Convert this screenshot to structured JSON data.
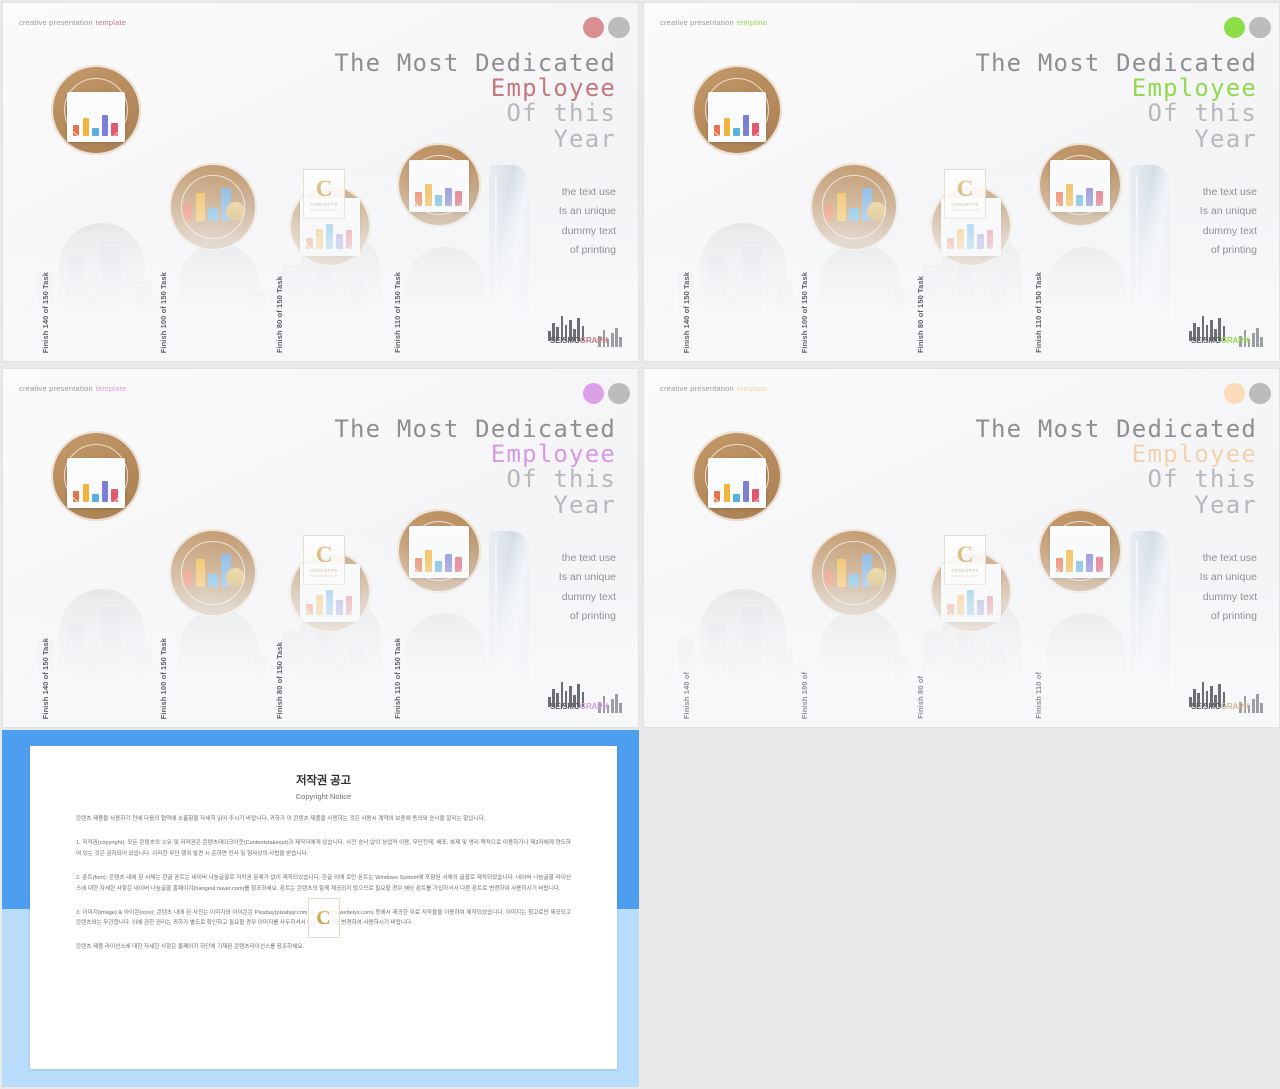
{
  "slides": [
    {
      "id": "slide-1",
      "accent": "#d98f92",
      "accent_text": "#c4787d",
      "eyebrow_plain": "creative presentation",
      "eyebrow_accent": "template",
      "headline": {
        "l1": "The Most Dedicated",
        "l2": "Employee",
        "l3": "Of this",
        "l4": "Year"
      },
      "body": [
        "the text use",
        "Is an unique",
        "dummy text",
        "of printing"
      ],
      "tasks": [
        "Finish 140 of 150 Task",
        "Finish 100 of 150 Task",
        "Finish 80 of 150 Task",
        "Finish 110 of 150 Task"
      ],
      "logo": {
        "part1": "SEISMO",
        "part2": "GRAPH"
      },
      "badge": {
        "letter": "C",
        "label": "CONCEPTS",
        "sub": "PRESENTATION"
      }
    },
    {
      "id": "slide-2",
      "accent": "#8ede4a",
      "accent_text": "#93d94f",
      "eyebrow_plain": "creative presentation",
      "eyebrow_accent": "template",
      "headline": {
        "l1": "The Most Dedicated",
        "l2": "Employee",
        "l3": "Of this",
        "l4": "Year"
      },
      "body": [
        "the text use",
        "Is an unique",
        "dummy text",
        "of printing"
      ],
      "tasks": [
        "Finish 140 of 150 Task",
        "Finish 100 of 150 Task",
        "Finish 80 of 150 Task",
        "Finish 110 of 150 Task"
      ],
      "logo": {
        "part1": "SEISMO",
        "part2": "GRAPH"
      },
      "badge": {
        "letter": "C",
        "label": "CONCEPTS",
        "sub": "PRESENTATION"
      }
    },
    {
      "id": "slide-3",
      "accent": "#dd9fe8",
      "accent_text": "#d79ae3",
      "eyebrow_plain": "creative presentation",
      "eyebrow_accent": "template",
      "headline": {
        "l1": "The Most Dedicated",
        "l2": "Employee",
        "l3": "Of this",
        "l4": "Year"
      },
      "body": [
        "the text use",
        "Is an unique",
        "dummy text",
        "of printing"
      ],
      "tasks": [
        "Finish 140 of 150 Task",
        "Finish 100 of 150 Task",
        "Finish 80 of 150 Task",
        "Finish 110 of 150 Task"
      ],
      "logo": {
        "part1": "SEISMO",
        "part2": "GRAPH"
      },
      "badge": {
        "letter": "C",
        "label": "CONCEPTS",
        "sub": "PRESENTATION"
      }
    },
    {
      "id": "slide-4",
      "accent": "#fbdcb8",
      "accent_text": "#f2d2ae",
      "eyebrow_plain": "creative presentation",
      "eyebrow_accent": "template",
      "headline": {
        "l1": "The Most Dedicated",
        "l2": "Employee",
        "l3": "Of this",
        "l4": "Year"
      },
      "body": [
        "the text use",
        "Is an unique",
        "dummy text",
        "of printing"
      ],
      "tasks": [
        "Finish 140 of",
        "Finish 100 of",
        "Finish 80 of",
        "Finish 110 of"
      ],
      "logo": {
        "part1": "SEISMO",
        "part2": "GRAPH"
      },
      "badge": {
        "letter": "C",
        "label": "CONCEPTS",
        "sub": "PRESENTATION"
      }
    }
  ],
  "copyright_doc": {
    "title": "저작권 공고",
    "subtitle": "Copyright Notice",
    "intro": "콘텐츠 제품을 사용하기 전에 다음의 협약에 소홀함을 자세히 읽어 주시기 바랍니다. 귀하가 이 콘텐츠 제품을 사용하는 것은 사용시 계약의 보증에 동의와 승낙을 알리는 말입니다.",
    "section1": "1. 저작권(copyright): 모든 콘텐츠의 소유 및 저작권은 콘텐츠테이크아웃(Contentstakeout)과 제작자에게 있습니다. 사전 승낙 없이 상업적 이용, 무단전재, 배포, 복제 및 영리 목적으로 이용하거나 제3자에게 양도하여 있는 것은 금지되어 있습니다. 이러한 무단 행위 발견 시 준하면 민사 및 형사상의 사법을 받습니다.",
    "section2": "2. 폰트(font): 콘텐츠 내에 된 서체는 한글 폰트는 네이버 나눔글꼴로 저작권 문제가 없이 제작되었습니다. 한글 외에 로만 폰트는 Windows System에 포함된 서체의 글꼴로 제작되었습니다. 네이버 나눔글꼴 라이선스에 대한 자세한 사항은 네이버 나눔글꼴 홈페이지(hangeul.naver.com)를 참조하세요. 폰트는 콘텐츠의 함께 제공되지 않으므로 필요할 경우 해당 폰트를 가입하셔서 다른 폰트로 변경하여 사용하시기 바랍니다.",
    "section3": "3. 이미지(image) & 아이콘(icon): 콘텐츠 내에 된 사진는 이미지와 아이콘은 Pixabay(pixabay.com)와 Webelyx(webelyx.com) 등에서 제공한 무료 저작물을 이용하여 제작되었습니다. 이미지는 참고로만 제공되고 콘텐츠와는 무관합니다. 이에 관한 권리는 귀하가 별도로 확인하고 필요할 경우 이미지를 사두하셔서 다른 이미지를 변경하여 사용하시기 바랍니다.",
    "footer": "콘텐츠 제품 라이선스에 대한 자세한 사항은 홈페이지 하단에 기재된 콘텐츠라이선스를 참조하세요.",
    "watermark_letter": "C"
  }
}
